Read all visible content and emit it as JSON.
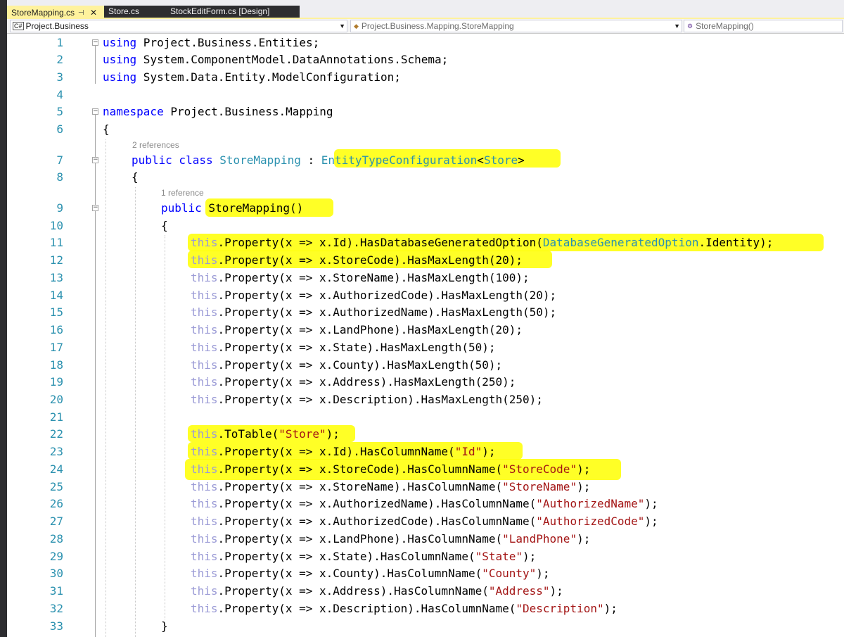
{
  "tabs": [
    {
      "label": "StoreMapping.cs",
      "pin": "⊣",
      "close": "✕"
    },
    {
      "label": "Store.cs"
    },
    {
      "label": "StockEditForm.cs [Design]"
    }
  ],
  "nav": {
    "project": "Project.Business",
    "project_icon": "C#",
    "type": "Project.Business.Mapping.StoreMapping",
    "member": "StoreMapping()"
  },
  "lens": {
    "class_refs": "2 references",
    "ctor_refs": "1 reference"
  },
  "lines": [
    {
      "n": "1",
      "code": [
        [
          "kw",
          "using"
        ],
        [
          "",
          " Project.Business.Entities;"
        ]
      ]
    },
    {
      "n": "2",
      "code": [
        [
          "kw",
          "using"
        ],
        [
          "",
          " System.ComponentModel.DataAnnotations.Schema;"
        ]
      ]
    },
    {
      "n": "3",
      "code": [
        [
          "kw",
          "using"
        ],
        [
          "",
          " System.Data.Entity.ModelConfiguration;"
        ]
      ]
    },
    {
      "n": "4",
      "code": []
    },
    {
      "n": "5",
      "code": [
        [
          "kw",
          "namespace"
        ],
        [
          "",
          " Project.Business.Mapping"
        ]
      ]
    },
    {
      "n": "6",
      "code": [
        [
          "",
          "{"
        ]
      ]
    },
    {
      "n": "7",
      "code": [
        [
          "kw",
          "public class"
        ],
        [
          "",
          " "
        ],
        [
          "ty",
          "StoreMapping"
        ],
        [
          "",
          " : "
        ],
        [
          "ty",
          "EntityTypeConfiguration"
        ],
        [
          "",
          "<"
        ],
        [
          "ty",
          "Store"
        ],
        [
          "",
          ">"
        ]
      ]
    },
    {
      "n": "8",
      "code": [
        [
          "",
          "{"
        ]
      ]
    },
    {
      "n": "9",
      "code": [
        [
          "kw",
          "public"
        ],
        [
          "",
          " StoreMapping()"
        ]
      ]
    },
    {
      "n": "10",
      "code": [
        [
          "",
          "{"
        ]
      ]
    },
    {
      "n": "11",
      "code": [
        [
          "th",
          "this"
        ],
        [
          "",
          ".Property(x => x.Id).HasDatabaseGeneratedOption("
        ],
        [
          "ty",
          "DatabaseGeneratedOption"
        ],
        [
          "",
          ".Identity);"
        ]
      ]
    },
    {
      "n": "12",
      "code": [
        [
          "th",
          "this"
        ],
        [
          "",
          ".Property(x => x.StoreCode).HasMaxLength(20);"
        ]
      ]
    },
    {
      "n": "13",
      "code": [
        [
          "th",
          "this"
        ],
        [
          "",
          ".Property(x => x.StoreName).HasMaxLength(100);"
        ]
      ]
    },
    {
      "n": "14",
      "code": [
        [
          "th",
          "this"
        ],
        [
          "",
          ".Property(x => x.AuthorizedCode).HasMaxLength(20);"
        ]
      ]
    },
    {
      "n": "15",
      "code": [
        [
          "th",
          "this"
        ],
        [
          "",
          ".Property(x => x.AuthorizedName).HasMaxLength(50);"
        ]
      ]
    },
    {
      "n": "16",
      "code": [
        [
          "th",
          "this"
        ],
        [
          "",
          ".Property(x => x.LandPhone).HasMaxLength(20);"
        ]
      ]
    },
    {
      "n": "17",
      "code": [
        [
          "th",
          "this"
        ],
        [
          "",
          ".Property(x => x.State).HasMaxLength(50);"
        ]
      ]
    },
    {
      "n": "18",
      "code": [
        [
          "th",
          "this"
        ],
        [
          "",
          ".Property(x => x.County).HasMaxLength(50);"
        ]
      ]
    },
    {
      "n": "19",
      "code": [
        [
          "th",
          "this"
        ],
        [
          "",
          ".Property(x => x.Address).HasMaxLength(250);"
        ]
      ]
    },
    {
      "n": "20",
      "code": [
        [
          "th",
          "this"
        ],
        [
          "",
          ".Property(x => x.Description).HasMaxLength(250);"
        ]
      ]
    },
    {
      "n": "21",
      "code": []
    },
    {
      "n": "22",
      "code": [
        [
          "th",
          "this"
        ],
        [
          "",
          ".ToTable("
        ],
        [
          "str",
          "\"Store\""
        ],
        [
          "",
          ");"
        ]
      ]
    },
    {
      "n": "23",
      "code": [
        [
          "th",
          "this"
        ],
        [
          "",
          ".Property(x => x.Id).HasColumnName("
        ],
        [
          "str",
          "\"Id\""
        ],
        [
          "",
          ");"
        ]
      ]
    },
    {
      "n": "24",
      "code": [
        [
          "th",
          "this"
        ],
        [
          "",
          ".Property(x => x.StoreCode).HasColumnName("
        ],
        [
          "str",
          "\"StoreCode\""
        ],
        [
          "",
          ");"
        ]
      ]
    },
    {
      "n": "25",
      "code": [
        [
          "th",
          "this"
        ],
        [
          "",
          ".Property(x => x.StoreName).HasColumnName("
        ],
        [
          "str",
          "\"StoreName\""
        ],
        [
          "",
          ");"
        ]
      ]
    },
    {
      "n": "26",
      "code": [
        [
          "th",
          "this"
        ],
        [
          "",
          ".Property(x => x.AuthorizedName).HasColumnName("
        ],
        [
          "str",
          "\"AuthorizedName\""
        ],
        [
          "",
          ");"
        ]
      ]
    },
    {
      "n": "27",
      "code": [
        [
          "th",
          "this"
        ],
        [
          "",
          ".Property(x => x.AuthorizedCode).HasColumnName("
        ],
        [
          "str",
          "\"AuthorizedCode\""
        ],
        [
          "",
          ");"
        ]
      ]
    },
    {
      "n": "28",
      "code": [
        [
          "th",
          "this"
        ],
        [
          "",
          ".Property(x => x.LandPhone).HasColumnName("
        ],
        [
          "str",
          "\"LandPhone\""
        ],
        [
          "",
          ");"
        ]
      ]
    },
    {
      "n": "29",
      "code": [
        [
          "th",
          "this"
        ],
        [
          "",
          ".Property(x => x.State).HasColumnName("
        ],
        [
          "str",
          "\"State\""
        ],
        [
          "",
          ");"
        ]
      ]
    },
    {
      "n": "30",
      "code": [
        [
          "th",
          "this"
        ],
        [
          "",
          ".Property(x => x.County).HasColumnName("
        ],
        [
          "str",
          "\"County\""
        ],
        [
          "",
          ");"
        ]
      ]
    },
    {
      "n": "31",
      "code": [
        [
          "th",
          "this"
        ],
        [
          "",
          ".Property(x => x.Address).HasColumnName("
        ],
        [
          "str",
          "\"Address\""
        ],
        [
          "",
          ");"
        ]
      ]
    },
    {
      "n": "32",
      "code": [
        [
          "th",
          "this"
        ],
        [
          "",
          ".Property(x => x.Description).HasColumnName("
        ],
        [
          "str",
          "\"Description\""
        ],
        [
          "",
          ");"
        ]
      ]
    },
    {
      "n": "33",
      "code": [
        [
          "",
          "}"
        ]
      ]
    }
  ],
  "colors": {
    "keyword": "#0000ff",
    "type": "#2b91af",
    "string": "#a31515",
    "this": "#9b9bd6",
    "highlighter": "#ffff00",
    "active_tab": "#fff29d"
  }
}
